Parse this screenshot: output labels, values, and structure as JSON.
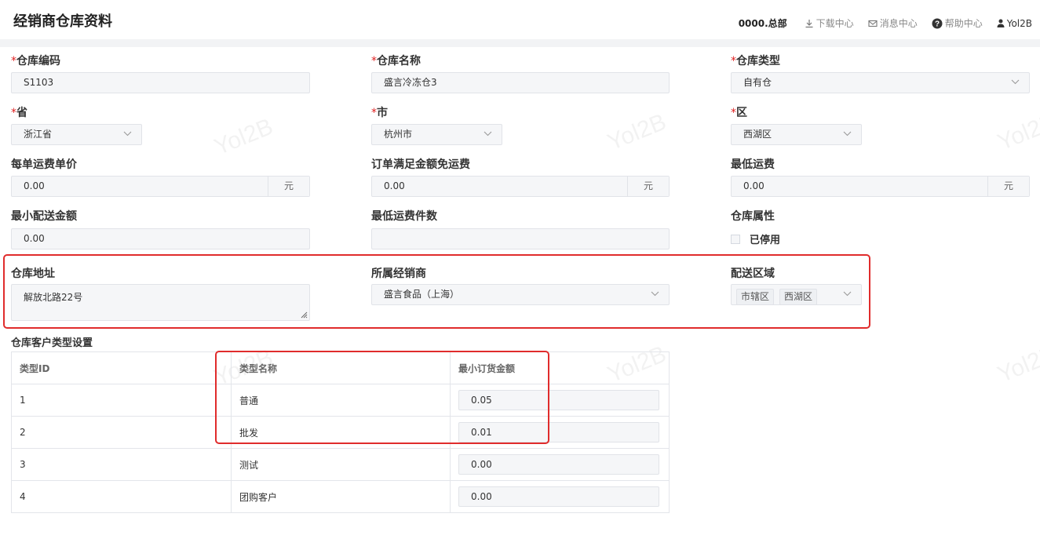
{
  "header": {
    "title": "经销商仓库资料",
    "org": "0000.总部",
    "download": "下载中心",
    "messages": "消息中心",
    "help": "帮助中心",
    "user": "Yol2B"
  },
  "form": {
    "warehouse_code": {
      "label": "仓库编码",
      "value": "S1103"
    },
    "warehouse_name": {
      "label": "仓库名称",
      "value": "盛言冷冻仓3"
    },
    "warehouse_type": {
      "label": "仓库类型",
      "value": "自有仓"
    },
    "province": {
      "label": "省",
      "value": "浙江省"
    },
    "city": {
      "label": "市",
      "value": "杭州市"
    },
    "district": {
      "label": "区",
      "value": "西湖区"
    },
    "freight_per_order": {
      "label": "每单运费单价",
      "value": "0.00",
      "unit": "元"
    },
    "free_shipping_amount": {
      "label": "订单满足金额免运费",
      "value": "0.00",
      "unit": "元"
    },
    "min_freight": {
      "label": "最低运费",
      "value": "0.00",
      "unit": "元"
    },
    "min_delivery_amount": {
      "label": "最小配送金额",
      "value": "0.00"
    },
    "min_freight_pieces": {
      "label": "最低运费件数",
      "value": ""
    },
    "warehouse_attr": {
      "label": "仓库属性",
      "checkbox_label": "已停用"
    },
    "address": {
      "label": "仓库地址",
      "value": "解放北路22号"
    },
    "dealer": {
      "label": "所属经销商",
      "value": "盛言食品（上海）"
    },
    "delivery_area": {
      "label": "配送区域",
      "tags": [
        "市辖区",
        "西湖区"
      ]
    }
  },
  "customer_types": {
    "title": "仓库客户类型设置",
    "columns": [
      "类型ID",
      "类型名称",
      "最小订货金额"
    ],
    "rows": [
      {
        "id": "1",
        "name": "普通",
        "amount": "0.05"
      },
      {
        "id": "2",
        "name": "批发",
        "amount": "0.01"
      },
      {
        "id": "3",
        "name": "测试",
        "amount": "0.00"
      },
      {
        "id": "4",
        "name": "团购客户",
        "amount": "0.00"
      }
    ]
  },
  "watermark": "Yol2B",
  "colors": {
    "required": "#e02020",
    "highlight_box": "#e02c2c",
    "input_bg": "#f5f6f8"
  }
}
